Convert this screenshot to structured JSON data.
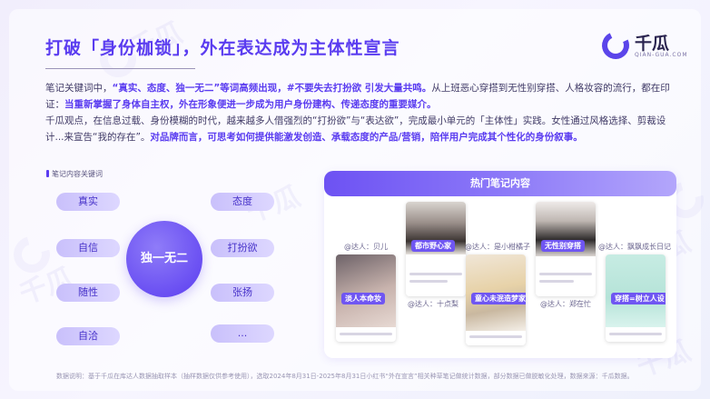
{
  "header": {
    "title": "打破「身份枷锁」，外在表达成为主体性宣言",
    "logo_text": "千瓜",
    "logo_sub": "QIAN-GUA.COM"
  },
  "body": {
    "p1_a": "笔记关键词中，",
    "p1_b": "“真实、态度、独一无二”等词高频出现，#不要失去打扮欲 引发大量共鸣。",
    "p1_c": "从上班恶心穿搭到无性别穿搭、人格妆容的流行，都在印证：",
    "p1_d": "当重新掌握了身体自主权，外在形象便进一步成为用户身份建构、传递态度的重要媒介。",
    "p2_a": "千瓜观点，在信息过载、身份模糊的时代，越来越多人借强烈的“打扮欲”与“表达欲”，完成最小单元的「主体性」实践。女性通过风格选择、剪裁设计...来宣告“我的存在”。",
    "p2_b": "对品牌而言，可思考如何提供能激发创造、承载态度的产品/营销，陪伴用户完成其个性化的身份叙事。"
  },
  "keywords": {
    "label": "笔记内容关键词",
    "center": "独一无二",
    "left": [
      "真实",
      "自信",
      "随性",
      "自洽"
    ],
    "right": [
      "态度",
      "打扮欲",
      "张扬",
      "..."
    ]
  },
  "notes": {
    "header": "热门笔记内容",
    "cards": [
      {
        "tag": "淡人本命妆",
        "author": "@达人：贝儿"
      },
      {
        "tag": "都市野心家",
        "author": "@达人：十点梨"
      },
      {
        "tag": "童心未泯造梦家",
        "author": "@达人：是小柑橘子"
      },
      {
        "tag": "无性别穿搭",
        "author": "@达人：郑在忙"
      },
      {
        "tag": "穿搭=树立人设",
        "author": "@达人：飘飘成长日记"
      }
    ]
  },
  "footer": "数据说明：基于千瓜在库达人数据抽取样本（抽样数据仅供参考使用），选取2024年8月31日-2025年8月31日小红书“外在宣言”相关种草笔记做统计数据，部分数据已做脱敏化处理，数据来源：千瓜数据。",
  "colors": {
    "accent": "#5a3cf0",
    "pill": "#d3cbfc"
  }
}
